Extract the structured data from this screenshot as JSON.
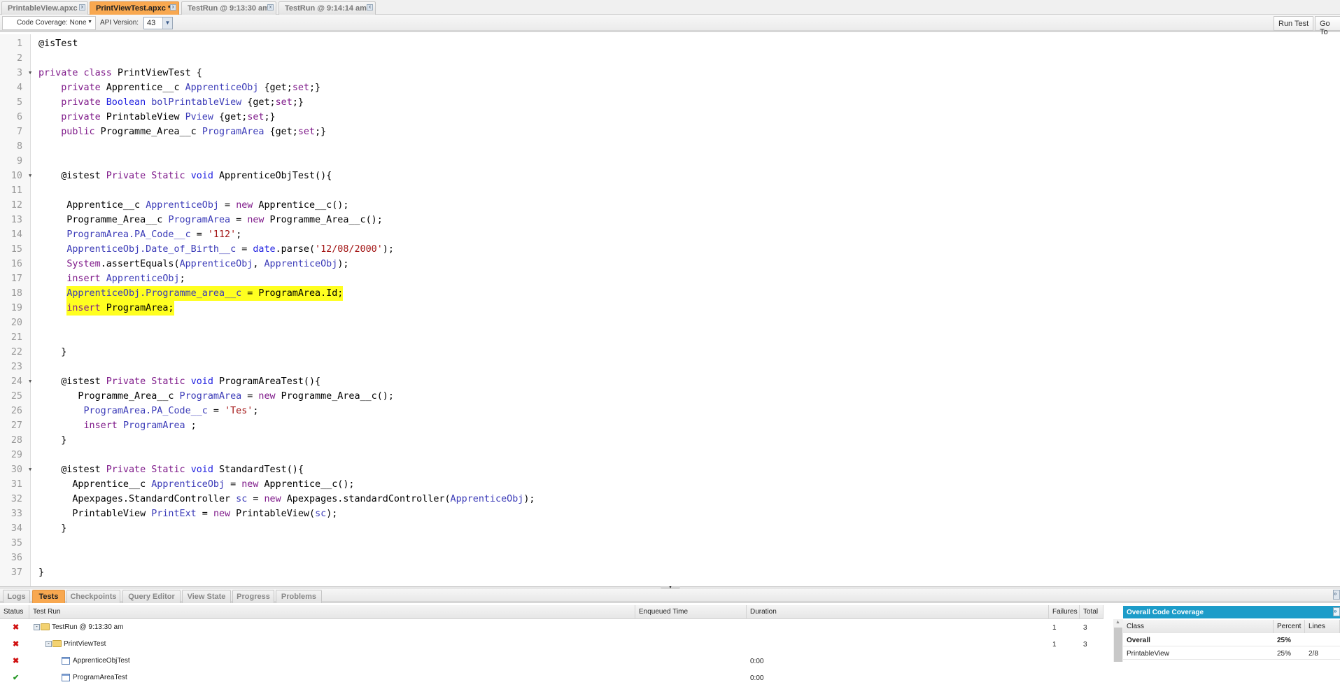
{
  "file_tabs": [
    {
      "label": "PrintableView.apxc",
      "active": false
    },
    {
      "label": "PrintViewTest.apxc *",
      "active": true
    },
    {
      "label": "TestRun @ 9:13:30 am",
      "active": false
    },
    {
      "label": "TestRun @ 9:14:14 am",
      "active": false
    }
  ],
  "toolbar": {
    "code_coverage": "Code Coverage: None",
    "api_label": "API Version:",
    "api_version": "43",
    "run_test": "Run Test",
    "go_to": "Go To"
  },
  "editor": {
    "folds": [
      3,
      10,
      24,
      30
    ],
    "highlighted_lines": [
      18,
      19
    ],
    "highlight_color": "#ffff20",
    "lines": [
      [
        [
          "@isTest",
          ""
        ]
      ],
      [],
      [
        [
          "private class ",
          "k"
        ],
        [
          "PrintViewTest {",
          ""
        ]
      ],
      [
        [
          "    ",
          ""
        ],
        [
          "private",
          "k"
        ],
        [
          " Apprentice__c ",
          ""
        ],
        [
          "ApprenticeObj",
          "v"
        ],
        [
          " {get;",
          ""
        ],
        [
          "set",
          "k"
        ],
        [
          ";}",
          ""
        ]
      ],
      [
        [
          "    ",
          ""
        ],
        [
          "private",
          "k"
        ],
        [
          " ",
          ""
        ],
        [
          "Boolean",
          "t"
        ],
        [
          " ",
          ""
        ],
        [
          "bolPrintableView",
          "v"
        ],
        [
          " {get;",
          ""
        ],
        [
          "set",
          "k"
        ],
        [
          ";}",
          ""
        ]
      ],
      [
        [
          "    ",
          ""
        ],
        [
          "private",
          "k"
        ],
        [
          " PrintableView ",
          ""
        ],
        [
          "Pview",
          "v"
        ],
        [
          " {get;",
          ""
        ],
        [
          "set",
          "k"
        ],
        [
          ";}",
          ""
        ]
      ],
      [
        [
          "    ",
          ""
        ],
        [
          "public",
          "k"
        ],
        [
          " Programme_Area__c ",
          ""
        ],
        [
          "ProgramArea",
          "v"
        ],
        [
          " {get;",
          ""
        ],
        [
          "set",
          "k"
        ],
        [
          ";}",
          ""
        ]
      ],
      [],
      [],
      [
        [
          "    @istest ",
          ""
        ],
        [
          "Private Static",
          "k"
        ],
        [
          " ",
          ""
        ],
        [
          "void",
          "t"
        ],
        [
          " ApprenticeObjTest(){",
          ""
        ]
      ],
      [],
      [
        [
          "     Apprentice__c ",
          ""
        ],
        [
          "ApprenticeObj",
          "v"
        ],
        [
          " = ",
          ""
        ],
        [
          "new",
          "k"
        ],
        [
          " Apprentice__c();",
          ""
        ]
      ],
      [
        [
          "     Programme_Area__c ",
          ""
        ],
        [
          "ProgramArea",
          "v"
        ],
        [
          " = ",
          ""
        ],
        [
          "new",
          "k"
        ],
        [
          " Programme_Area__c();",
          ""
        ]
      ],
      [
        [
          "     ",
          ""
        ],
        [
          "ProgramArea.PA_Code__c",
          "v"
        ],
        [
          " = ",
          ""
        ],
        [
          "'112'",
          "s"
        ],
        [
          ";",
          ""
        ]
      ],
      [
        [
          "     ",
          ""
        ],
        [
          "ApprenticeObj.Date_of_Birth__c",
          "v"
        ],
        [
          " = ",
          ""
        ],
        [
          "date",
          "t"
        ],
        [
          ".parse(",
          ""
        ],
        [
          "'12/08/2000'",
          "s"
        ],
        [
          ");",
          ""
        ]
      ],
      [
        [
          "     ",
          ""
        ],
        [
          "System",
          "k"
        ],
        [
          ".assertEquals(",
          ""
        ],
        [
          "ApprenticeObj",
          "v"
        ],
        [
          ", ",
          ""
        ],
        [
          "ApprenticeObj",
          "v"
        ],
        [
          ");",
          ""
        ]
      ],
      [
        [
          "     ",
          ""
        ],
        [
          "insert",
          "k"
        ],
        [
          " ",
          ""
        ],
        [
          "ApprenticeObj",
          "v"
        ],
        [
          ";",
          ""
        ]
      ],
      [
        [
          "     ",
          ""
        ],
        [
          "ApprenticeObj.Programme_area__c",
          "v hl"
        ],
        [
          " = ProgramArea.Id;",
          "hl"
        ]
      ],
      [
        [
          "     ",
          ""
        ],
        [
          "insert",
          "k hl"
        ],
        [
          " ProgramArea;",
          "hl"
        ]
      ],
      [],
      [],
      [
        [
          "    }",
          ""
        ]
      ],
      [],
      [
        [
          "    @istest ",
          ""
        ],
        [
          "Private Static",
          "k"
        ],
        [
          " ",
          ""
        ],
        [
          "void",
          "t"
        ],
        [
          " ProgramAreaTest(){",
          ""
        ]
      ],
      [
        [
          "       Programme_Area__c ",
          ""
        ],
        [
          "ProgramArea",
          "v"
        ],
        [
          " = ",
          ""
        ],
        [
          "new",
          "k"
        ],
        [
          " Programme_Area__c();",
          ""
        ]
      ],
      [
        [
          "        ",
          ""
        ],
        [
          "ProgramArea.PA_Code__c",
          "v"
        ],
        [
          " = ",
          ""
        ],
        [
          "'Tes'",
          "s"
        ],
        [
          ";",
          ""
        ]
      ],
      [
        [
          "        ",
          ""
        ],
        [
          "insert",
          "k"
        ],
        [
          " ",
          ""
        ],
        [
          "ProgramArea",
          "v"
        ],
        [
          " ;",
          ""
        ]
      ],
      [
        [
          "    }",
          ""
        ]
      ],
      [],
      [
        [
          "    @istest ",
          ""
        ],
        [
          "Private Static",
          "k"
        ],
        [
          " ",
          ""
        ],
        [
          "void",
          "t"
        ],
        [
          " StandardTest(){",
          ""
        ]
      ],
      [
        [
          "      Apprentice__c ",
          ""
        ],
        [
          "ApprenticeObj",
          "v"
        ],
        [
          " = ",
          ""
        ],
        [
          "new",
          "k"
        ],
        [
          " Apprentice__c();",
          ""
        ]
      ],
      [
        [
          "      Apexpages.StandardController ",
          ""
        ],
        [
          "sc",
          "v"
        ],
        [
          " = ",
          ""
        ],
        [
          "new",
          "k"
        ],
        [
          " Apexpages.standardController(",
          ""
        ],
        [
          "ApprenticeObj",
          "v"
        ],
        [
          ");",
          ""
        ]
      ],
      [
        [
          "      PrintableView ",
          ""
        ],
        [
          "PrintExt",
          "v"
        ],
        [
          " = ",
          ""
        ],
        [
          "new",
          "k"
        ],
        [
          " PrintableView(",
          ""
        ],
        [
          "sc",
          "v"
        ],
        [
          ");",
          ""
        ]
      ],
      [
        [
          "    }",
          ""
        ]
      ],
      [],
      [],
      [
        [
          "}",
          ""
        ]
      ]
    ]
  },
  "bottom_tabs": [
    {
      "label": "Logs",
      "active": false
    },
    {
      "label": "Tests",
      "active": true
    },
    {
      "label": "Checkpoints",
      "active": false
    },
    {
      "label": "Query Editor",
      "active": false
    },
    {
      "label": "View State",
      "active": false
    },
    {
      "label": "Progress",
      "active": false
    },
    {
      "label": "Problems",
      "active": false
    }
  ],
  "tests": {
    "columns": [
      "Status",
      "Test Run",
      "Enqueued Time",
      "Duration",
      "Failures",
      "Total"
    ],
    "rows": [
      {
        "status": "fail",
        "name": "TestRun @ 9:13:30 am",
        "type": "folder",
        "depth": 0,
        "enqueued": "",
        "duration": "",
        "failures": "1",
        "total": "3"
      },
      {
        "status": "fail",
        "name": "PrintViewTest",
        "type": "folder",
        "depth": 1,
        "enqueued": "",
        "duration": "",
        "failures": "1",
        "total": "3"
      },
      {
        "status": "fail",
        "name": "ApprenticeObjTest",
        "type": "method",
        "depth": 2,
        "enqueued": "",
        "duration": "0:00",
        "failures": "",
        "total": ""
      },
      {
        "status": "pass",
        "name": "ProgramAreaTest",
        "type": "method",
        "depth": 2,
        "enqueued": "",
        "duration": "0:00",
        "failures": "",
        "total": ""
      }
    ]
  },
  "coverage": {
    "title": "Overall Code Coverage",
    "columns": [
      "Class",
      "Percent",
      "Lines"
    ],
    "rows": [
      {
        "class": "Overall",
        "percent": "25%",
        "lines": "",
        "bold": true
      },
      {
        "class": "PrintableView",
        "percent": "25%",
        "lines": "2/8",
        "bold": false
      }
    ]
  }
}
